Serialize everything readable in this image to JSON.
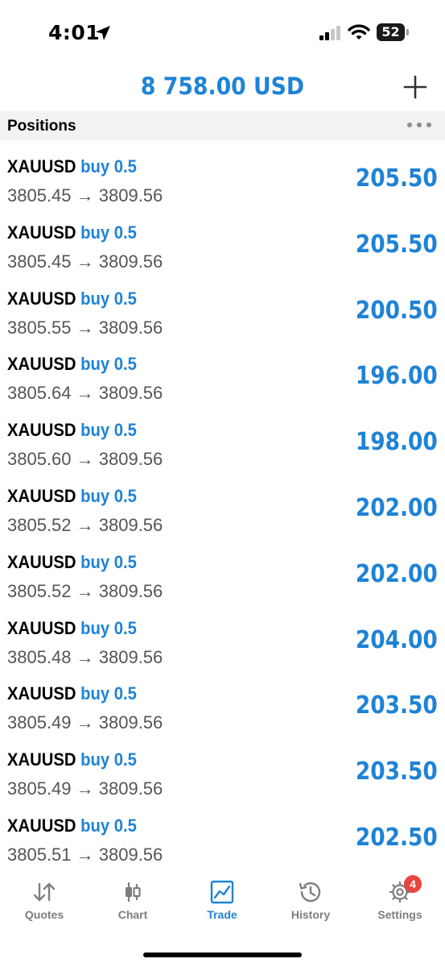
{
  "status_bar": {
    "time": "4:01",
    "battery": "52"
  },
  "header": {
    "balance": "8 758.00 USD"
  },
  "positions": {
    "title": "Positions",
    "rows": [
      {
        "symbol": "XAUUSD",
        "side": "buy 0.5",
        "prices": "3805.45 → 3809.56",
        "profit": "205.50"
      },
      {
        "symbol": "XAUUSD",
        "side": "buy 0.5",
        "prices": "3805.45 → 3809.56",
        "profit": "205.50"
      },
      {
        "symbol": "XAUUSD",
        "side": "buy 0.5",
        "prices": "3805.55 → 3809.56",
        "profit": "200.50"
      },
      {
        "symbol": "XAUUSD",
        "side": "buy 0.5",
        "prices": "3805.64 → 3809.56",
        "profit": "196.00"
      },
      {
        "symbol": "XAUUSD",
        "side": "buy 0.5",
        "prices": "3805.60 → 3809.56",
        "profit": "198.00"
      },
      {
        "symbol": "XAUUSD",
        "side": "buy 0.5",
        "prices": "3805.52 → 3809.56",
        "profit": "202.00"
      },
      {
        "symbol": "XAUUSD",
        "side": "buy 0.5",
        "prices": "3805.52 → 3809.56",
        "profit": "202.00"
      },
      {
        "symbol": "XAUUSD",
        "side": "buy 0.5",
        "prices": "3805.48 → 3809.56",
        "profit": "204.00"
      },
      {
        "symbol": "XAUUSD",
        "side": "buy 0.5",
        "prices": "3805.49 → 3809.56",
        "profit": "203.50"
      },
      {
        "symbol": "XAUUSD",
        "side": "buy 0.5",
        "prices": "3805.49 → 3809.56",
        "profit": "203.50"
      },
      {
        "symbol": "XAUUSD",
        "side": "buy 0.5",
        "prices": "3805.51 → 3809.56",
        "profit": "202.50"
      }
    ]
  },
  "tab_bar": {
    "quotes": "Quotes",
    "chart": "Chart",
    "trade": "Trade",
    "history": "History",
    "settings": "Settings",
    "settings_badge": "4"
  },
  "colors": {
    "accent": "#1e83d6",
    "badge": "#e8453c",
    "tab_inactive": "#7d7d82"
  },
  "icons": [
    "location-arrow-icon",
    "signal-icon",
    "wifi-icon",
    "battery-icon",
    "plus-icon",
    "more-dots-icon",
    "quotes-icon",
    "chart-icon",
    "trade-icon",
    "history-icon",
    "settings-icon"
  ]
}
